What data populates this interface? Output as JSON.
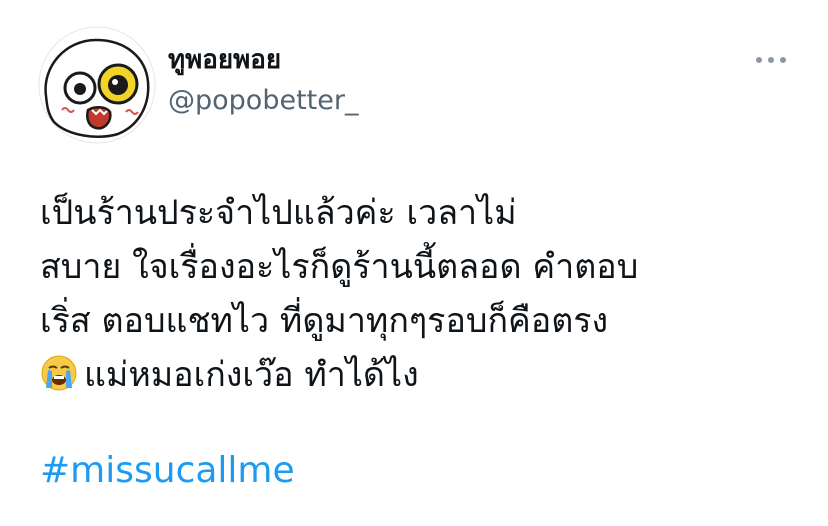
{
  "tweet": {
    "display_name": "ทูพอยพอย",
    "handle": "@popobetter_",
    "more_icon": "more-horizontal-icon",
    "body_lines": [
      "เป็นร้านประจำไปแล้วค่ะ เวลาไม่",
      "สบาย ใจเรื่องอะไรก็ดูร้านนี้ตลอด คำตอบ",
      "เริ่ส ตอบแชทไว ที่ดูมาทุกๆรอบก็คือตรง"
    ],
    "last_line_emoji": "loudly-crying-face-icon",
    "last_line_text": "แม่หมอเก่งเว๊อ ทำได้ไง",
    "hashtag": "#missucallme",
    "colors": {
      "hashtag": "#1d9bf0",
      "handle": "#536471",
      "text": "#0f1419"
    }
  }
}
